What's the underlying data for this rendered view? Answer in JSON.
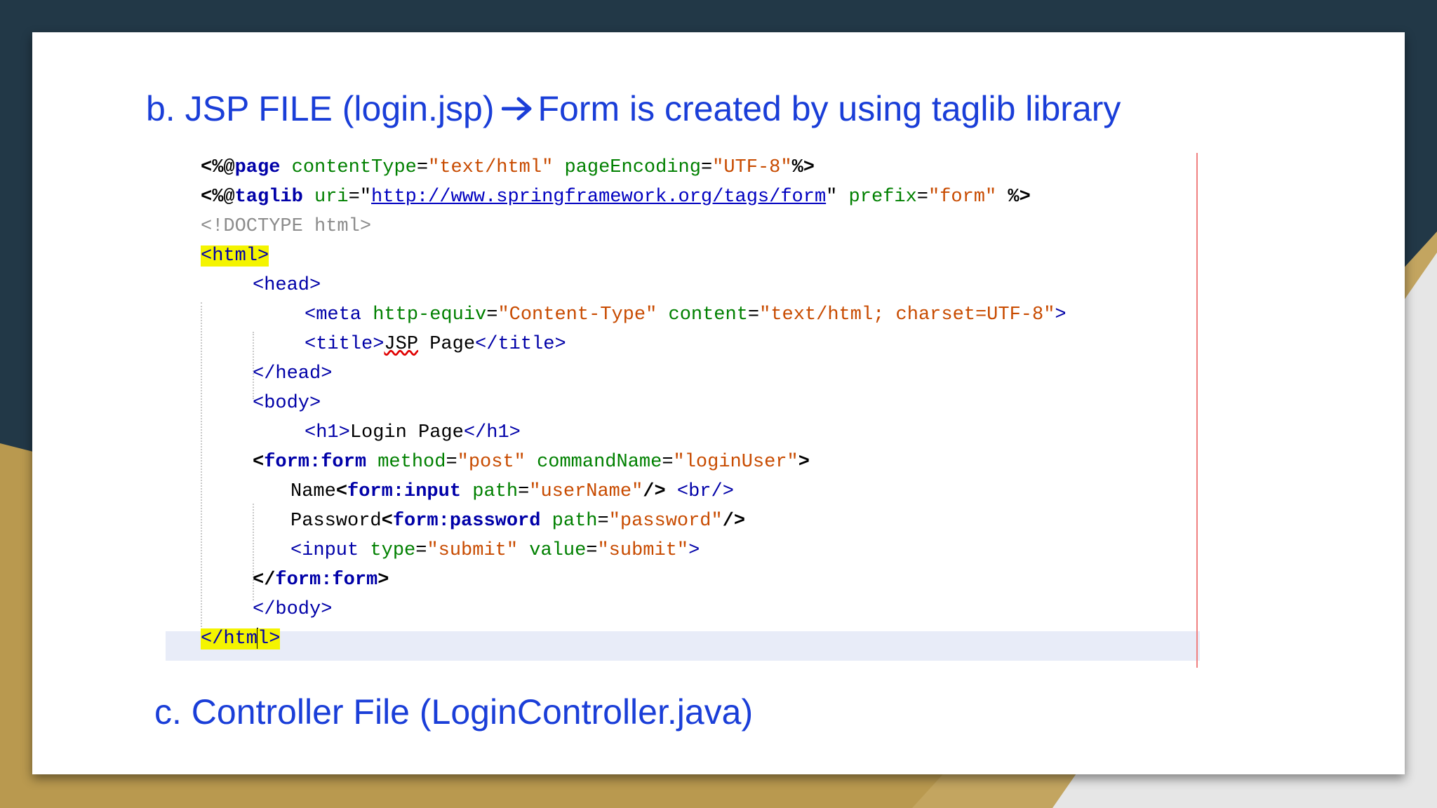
{
  "slide": {
    "heading_b_left": "b. JSP FILE (login.jsp)",
    "heading_b_right": "Form is created by using taglib library",
    "heading_c": "c. Controller File (LoginController.java)"
  },
  "code": {
    "l1": {
      "a": "<%@",
      "b": "page",
      "c": " contentType",
      "d": "=",
      "e": "\"text/html\"",
      "f": " pageEncoding",
      "g": "=",
      "h": "\"UTF-8\"",
      "i": "%>"
    },
    "l2": {
      "a": "<%@",
      "b": "taglib",
      "c": " uri",
      "d": "=\"",
      "e": "http://www.springframework.org/tags/form",
      "f": "\"",
      "g": " prefix",
      "h": "=",
      "i": "\"form\"",
      "j": " %>"
    },
    "l3": "<!DOCTYPE html>",
    "l4": "<html>",
    "l5": "<head>",
    "l6": {
      "a": "<meta",
      "b": " http-equiv",
      "c": "=",
      "d": "\"Content-Type\"",
      "e": " content",
      "f": "=",
      "g": "\"text/html; charset=UTF-8\"",
      "h": ">"
    },
    "l7": {
      "a": "<title>",
      "b": "JSP",
      "c": " Page",
      "d": "</title>"
    },
    "l8": "</head>",
    "l9": "<body>",
    "l10": {
      "a": "<h1>",
      "b": "Login Page",
      "c": "</h1>"
    },
    "l11": {
      "a": "<",
      "b": "form:form",
      "c": " method",
      "d": "=",
      "e": "\"post\"",
      "f": " commandName",
      "g": "=",
      "h": "\"loginUser\"",
      "i": ">"
    },
    "l12": {
      "a": "Name",
      "b": "<",
      "c": "form:input",
      "d": " path",
      "e": "=",
      "f": "\"userName\"",
      "g": "/>",
      "h": " <br/>"
    },
    "l13": {
      "a": "Password",
      "b": "<",
      "c": "form:password",
      "d": " path",
      "e": "=",
      "f": "\"password\"",
      "g": "/>"
    },
    "l14": {
      "a": "<input",
      "b": " type",
      "c": "=",
      "d": "\"submit\"",
      "e": " value",
      "f": "=",
      "g": "\"submit\"",
      "h": ">"
    },
    "l15": {
      "a": "</",
      "b": "form:form",
      "c": ">"
    },
    "l16": "</body>",
    "l17": {
      "a": "</htm",
      "b": "l>"
    }
  },
  "colors": {
    "heading": "#1a3ed8",
    "tag": "#0000a8",
    "attribute": "#008000",
    "string": "#c84b00",
    "highlight": "#f4f400",
    "background_dark": "#223847",
    "background_gold": "#b9994f"
  },
  "icons": {
    "arrow": "right-arrow-icon"
  }
}
